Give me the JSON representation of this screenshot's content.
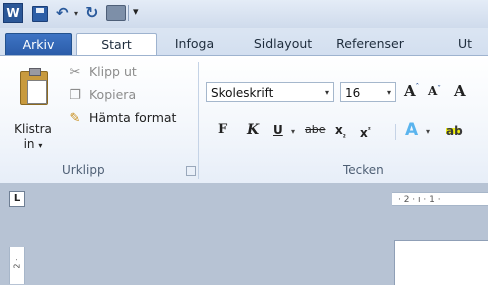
{
  "quick_access": {
    "app_icon_letter": "W",
    "icons": [
      "save-icon",
      "undo-icon",
      "redo-icon",
      "print-preview-icon",
      "customize-qat-icon"
    ],
    "undo_glyph": "↶",
    "dropdown_glyph": "▾",
    "redo_glyph": "↻",
    "more_glyph": "▾"
  },
  "tabs": [
    {
      "label": "Arkiv"
    },
    {
      "label": "Start"
    },
    {
      "label": "Infoga"
    },
    {
      "label": "Sidlayout"
    },
    {
      "label": "Referenser"
    },
    {
      "label": "Ut"
    }
  ],
  "clipboard": {
    "paste_label": "Klistra",
    "paste_label2": "in",
    "dropdown_glyph": "▾",
    "cut_label": "Klipp ut",
    "copy_label": "Kopiera",
    "format_label": "Hämta format",
    "cut_glyph": "✂",
    "copy_glyph": "❐",
    "brush_glyph": "✎",
    "group_label": "Urklipp"
  },
  "font": {
    "name": "Skoleskrift",
    "size": "16",
    "combo_glyph": "▾",
    "grow_glyph": "A",
    "shrink_glyph": "A",
    "mark_glyph": "ˆ",
    "shrink_mark_glyph": "ˇ",
    "more_glyph": "A",
    "bold_glyph": "F",
    "italic_glyph": "K",
    "underline_glyph": "U",
    "strike_glyph": "abe",
    "sub_base": "x",
    "sub_mark": "₂",
    "sup_base": "x",
    "sup_mark": "²",
    "effects_glyph": "A",
    "highlight_glyph": "ab",
    "group_label": "Tecken"
  },
  "document": {
    "tab_stop_glyph": "L",
    "ruler_top_text": "· 2 · ı · 1 ·",
    "ruler_left_text": "2 ·"
  },
  "colors": {
    "file_tab": "#2a5ba8",
    "ribbon_bg": "#f5f8fc",
    "workspace": "#b7c3d4"
  }
}
